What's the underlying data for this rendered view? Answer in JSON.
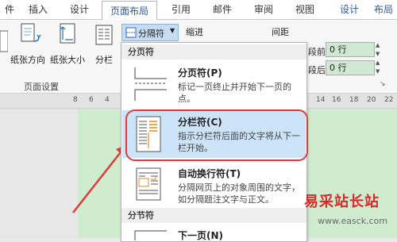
{
  "tabs": [
    {
      "label": "件",
      "active": false
    },
    {
      "label": "插入",
      "active": false
    },
    {
      "label": "设计",
      "active": false
    },
    {
      "label": "页面布局",
      "active": true
    },
    {
      "label": "引用",
      "active": false
    },
    {
      "label": "邮件",
      "active": false
    },
    {
      "label": "审阅",
      "active": false
    },
    {
      "label": "视图",
      "active": false
    },
    {
      "label": "设计",
      "active": false
    },
    {
      "label": "布局",
      "active": false
    }
  ],
  "ribbon": {
    "orientation": "纸张方向",
    "size": "纸张大小",
    "columns": "分栏",
    "breaks": "分隔符",
    "indent": "缩进",
    "spacing": "间距",
    "before_label": "段前:",
    "after_label": "段后:",
    "before_value": "0 行",
    "after_value": "0 行",
    "group_page_setup": "页面设置"
  },
  "ruler": [
    "8",
    "6",
    "4",
    "14",
    "16",
    "18",
    "20",
    "22"
  ],
  "menu": {
    "section_page": "分页符",
    "section_section": "分节符",
    "items": [
      {
        "title": "分页符(P)",
        "desc": "标记一页终止并开始下一页的点。"
      },
      {
        "title": "分栏符(C)",
        "desc": "指示分栏符后面的文字将从下一栏开始。"
      },
      {
        "title": "自动换行符(T)",
        "desc": "分隔网页上的对象周围的文字，如分隔题注文字与正文。"
      },
      {
        "title": "下一页(N)",
        "desc": ""
      }
    ]
  },
  "watermark": "易采站长站",
  "watermark_url": "www.easck.com",
  "colors": {
    "accent": "#2b579a",
    "highlight": "#cde3f8",
    "ring": "#e03a3a",
    "page": "#cfeccf"
  }
}
